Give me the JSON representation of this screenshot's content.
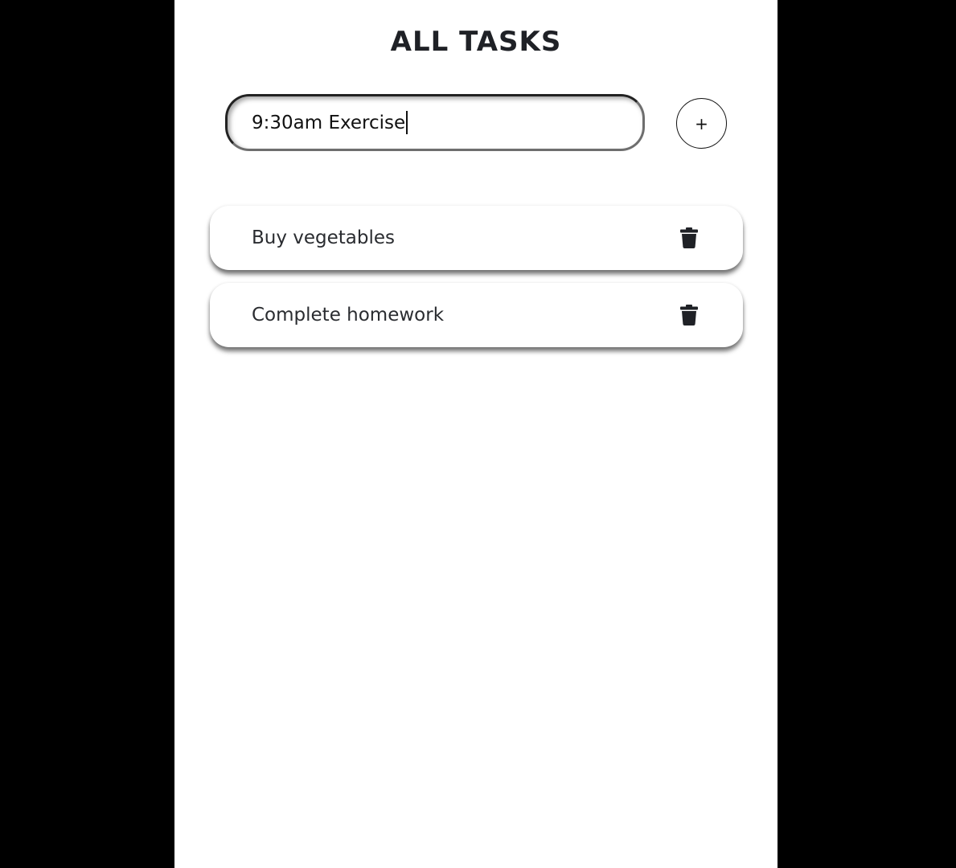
{
  "header": {
    "title": "ALL TASKS"
  },
  "new_task": {
    "value": "9:30am Exercise",
    "placeholder": "",
    "add_label": "+"
  },
  "tasks": [
    {
      "text": "Buy vegetables",
      "action_icon": "trash-icon"
    },
    {
      "text": "Complete homework",
      "action_icon": "trash-icon"
    }
  ],
  "colors": {
    "background": "#000000",
    "panel": "#ffffff",
    "text": "#1f2126",
    "icon": "#1f2126"
  }
}
